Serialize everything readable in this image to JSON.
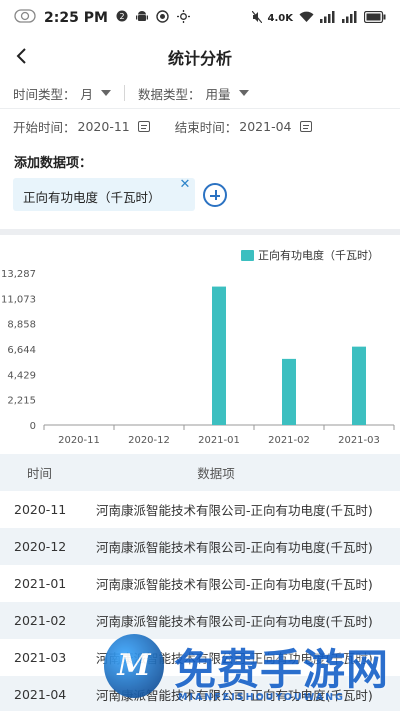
{
  "status_bar": {
    "time": "2:25 PM",
    "notif_count": "2",
    "net_speed": "4.0K"
  },
  "nav": {
    "title": "统计分析"
  },
  "filters": {
    "time_type_label": "时间类型：",
    "time_type_value": "月",
    "data_type_label": "数据类型：",
    "data_type_value": "用量",
    "start_label": "开始时间：",
    "start_value": "2020-11",
    "end_label": "结束时间：",
    "end_value": "2021-04"
  },
  "add_section": {
    "label": "添加数据项：",
    "chip_text": "正向有功电度（千瓦时）"
  },
  "chart_data": {
    "type": "bar",
    "categories": [
      "2020-11",
      "2020-12",
      "2021-01",
      "2021-02",
      "2021-03"
    ],
    "series": [
      {
        "name": "正向有功电度（千瓦时）",
        "values": [
          0,
          0,
          12100,
          5780,
          6850
        ],
        "color": "#3cbfc0"
      }
    ],
    "yticks": [
      "13,287",
      "11,073",
      "8,858",
      "6,644",
      "4,429",
      "2,215",
      "0"
    ],
    "ylim": [
      0,
      13287
    ],
    "legend_position": "top-right",
    "grid": false
  },
  "table": {
    "headers": {
      "time": "时间",
      "item": "数据项"
    },
    "rows": [
      {
        "time": "2020-11",
        "item": "河南康派智能技术有限公司-正向有功电度(千瓦时)"
      },
      {
        "time": "2020-12",
        "item": "河南康派智能技术有限公司-正向有功电度(千瓦时)"
      },
      {
        "time": "2021-01",
        "item": "河南康派智能技术有限公司-正向有功电度(千瓦时)"
      },
      {
        "time": "2021-02",
        "item": "河南康派智能技术有限公司-正向有功电度(千瓦时)"
      },
      {
        "time": "2021-03",
        "item": "河南康派智能技术有限公司-正向有功电度(千瓦时)"
      },
      {
        "time": "2021-04",
        "item": "河南康派智能技术有限公司-正向有功电度(千瓦时)"
      }
    ]
  },
  "watermark": {
    "logo_letter": "M",
    "text": "免费手游网",
    "sub": "MIANFEISHOUYOUWANG"
  }
}
